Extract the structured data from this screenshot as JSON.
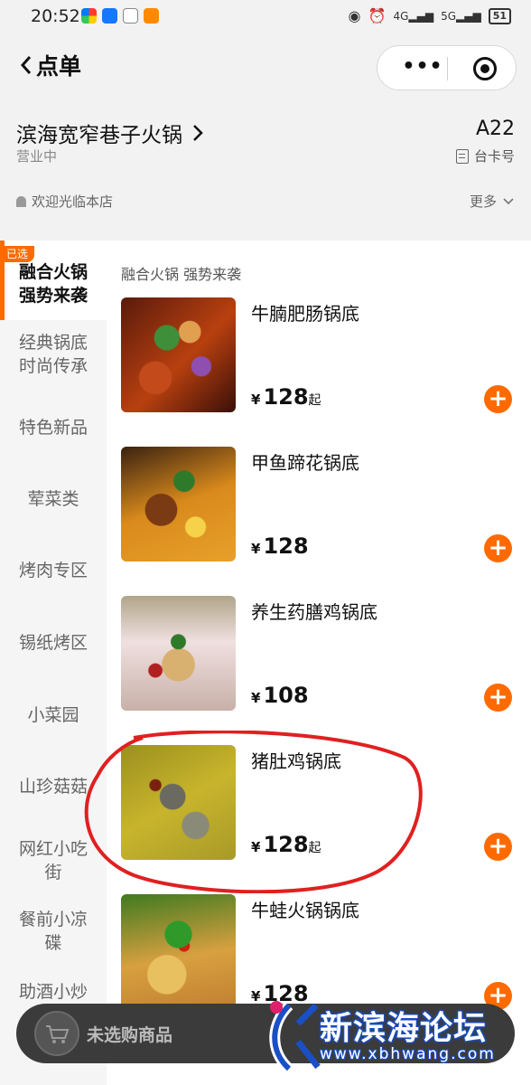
{
  "status_bar": {
    "time": "20:52",
    "signal_1": "4G",
    "signal_2": "5G",
    "battery": "51"
  },
  "nav": {
    "title": "点单"
  },
  "shop": {
    "name": "滨海宽窄巷子火锅",
    "status": "营业中",
    "table_no": "A22",
    "table_label": "台卡号",
    "welcome": "欢迎光临本店",
    "more": "更多"
  },
  "sidebar": {
    "selected_tag": "已选",
    "categories": [
      {
        "line1": "融合火锅",
        "line2": "强势来袭"
      },
      {
        "line1": "经典锅底",
        "line2": "时尚传承"
      },
      {
        "line1": "特色新品",
        "line2": ""
      },
      {
        "line1": "荤菜类",
        "line2": ""
      },
      {
        "line1": "烤肉专区",
        "line2": ""
      },
      {
        "line1": "锡纸烤区",
        "line2": ""
      },
      {
        "line1": "小菜园",
        "line2": ""
      },
      {
        "line1": "山珍菇菇",
        "line2": ""
      },
      {
        "line1": "网红小吃",
        "line2": "街"
      },
      {
        "line1": "餐前小凉",
        "line2": "碟"
      },
      {
        "line1": "助酒小炒",
        "line2": ""
      }
    ]
  },
  "main": {
    "section_title": "融合火锅 强势来袭",
    "currency": "¥",
    "dishes": [
      {
        "name": "牛腩肥肠锅底",
        "price": "128",
        "suffix": "起"
      },
      {
        "name": "甲鱼蹄花锅底",
        "price": "128",
        "suffix": ""
      },
      {
        "name": "养生药膳鸡锅底",
        "price": "108",
        "suffix": ""
      },
      {
        "name": "猪肚鸡锅底",
        "price": "128",
        "suffix": "起"
      },
      {
        "name": "牛蛙火锅锅底",
        "price": "128",
        "suffix": ""
      }
    ]
  },
  "cart": {
    "empty_text": "未选购商品"
  },
  "watermark": {
    "title": "新滨海论坛",
    "url": "www.xbhwang.com"
  },
  "colors": {
    "accent": "#ff6a00",
    "annotation": "#e02020"
  }
}
